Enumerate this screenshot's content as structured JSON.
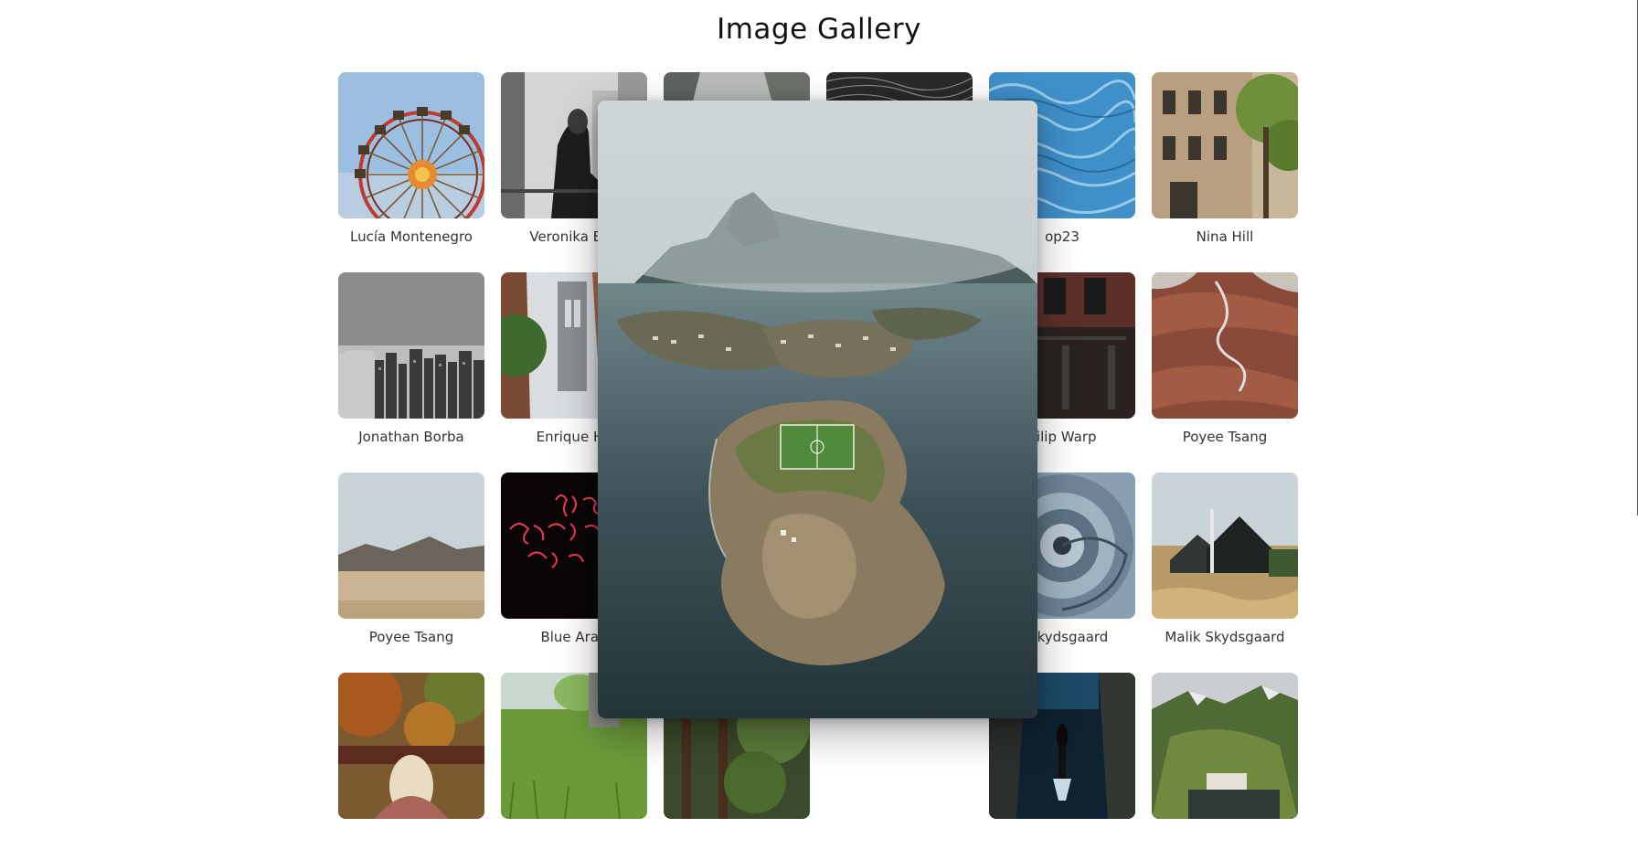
{
  "page": {
    "title": "Image Gallery"
  },
  "gallery": {
    "items": [
      {
        "caption": "Lucía Montenegro"
      },
      {
        "caption": "Veronika Byk"
      },
      {
        "caption": ""
      },
      {
        "caption": ""
      },
      {
        "caption": "op23"
      },
      {
        "caption": "Nina Hill"
      },
      {
        "caption": "Jonathan Borba"
      },
      {
        "caption": "Enrique Ho"
      },
      {
        "caption": ""
      },
      {
        "caption": ""
      },
      {
        "caption": "hilip Warp"
      },
      {
        "caption": "Poyee Tsang"
      },
      {
        "caption": "Poyee Tsang"
      },
      {
        "caption": "Blue Arau"
      },
      {
        "caption": ""
      },
      {
        "caption": ""
      },
      {
        "caption": "k Skydsgaard"
      },
      {
        "caption": "Malik Skydsgaard"
      },
      {
        "caption": ""
      },
      {
        "caption": ""
      },
      {
        "caption": ""
      },
      {
        "caption": ""
      },
      {
        "caption": ""
      },
      {
        "caption": ""
      }
    ]
  }
}
